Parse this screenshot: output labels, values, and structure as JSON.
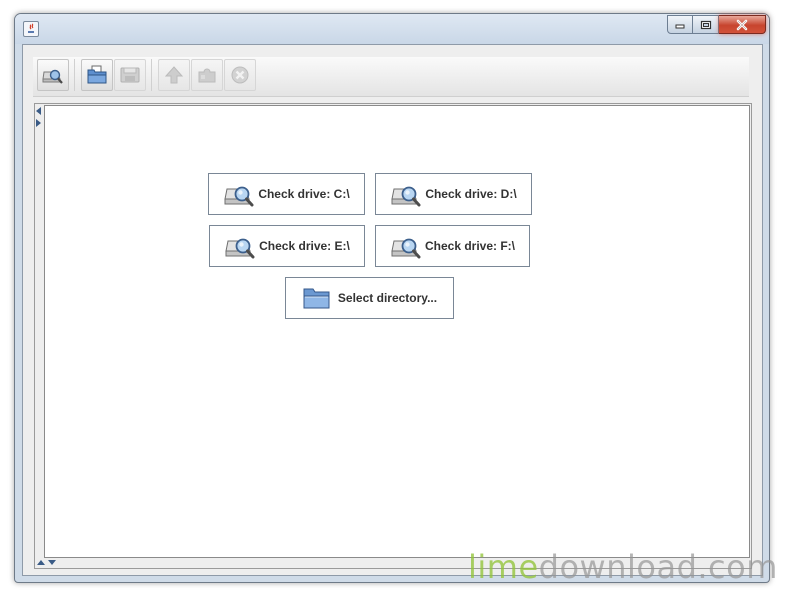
{
  "window": {
    "title": "",
    "caption_buttons": [
      "minimize-icon",
      "maximize-icon",
      "close-icon"
    ]
  },
  "toolbar": {
    "buttons": [
      {
        "icon": "drive-scan-icon",
        "enabled": true
      },
      {
        "icon": "open-folder-icon",
        "enabled": true
      },
      {
        "icon": "save-icon",
        "enabled": false
      },
      {
        "icon": "up-arrow-icon",
        "enabled": false
      },
      {
        "icon": "puzzle-icon",
        "enabled": false
      },
      {
        "icon": "stop-icon",
        "enabled": false
      }
    ]
  },
  "main": {
    "drive_buttons": [
      {
        "label": "Check drive: C:\\"
      },
      {
        "label": "Check drive: D:\\"
      },
      {
        "label": "Check drive: E:\\"
      },
      {
        "label": "Check drive: F:\\"
      }
    ],
    "select_directory": {
      "label": "Select directory..."
    }
  },
  "watermark": {
    "lime": "lime",
    "rest": "download.com"
  },
  "colors": {
    "accent": "#3a5b86",
    "close_button": "#c7442e",
    "watermark_green": "#92c43a"
  }
}
